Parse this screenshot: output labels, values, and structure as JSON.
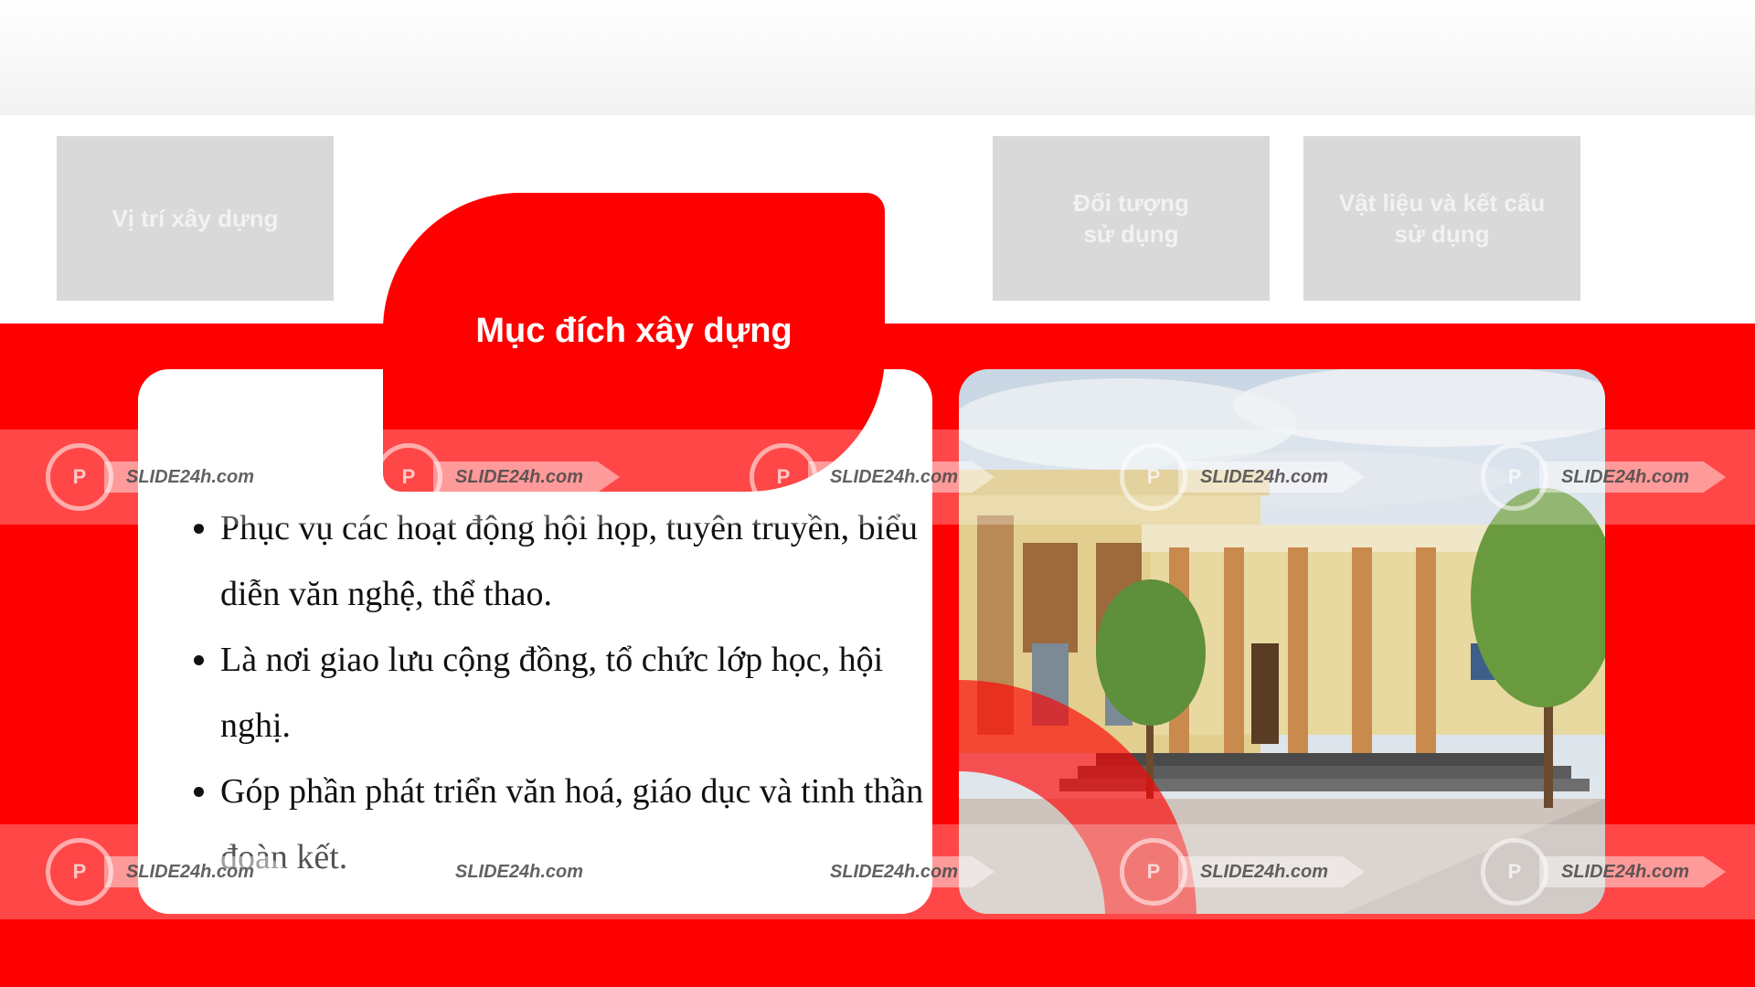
{
  "tabs": {
    "location": "Vị trí xây dựng",
    "users": "Đối tượng\nsử dụng",
    "materials": "Vật liệu và kết cấu\nsử dụng"
  },
  "active_tab": {
    "label": "Mục đích xây dựng"
  },
  "bullets": [
    "Phục vụ các hoạt động hội họp, tuyên truyền, biểu diễn văn nghệ, thể thao.",
    "Là nơi giao lưu cộng đồng, tổ chức lớp học, hội nghị.",
    "Góp phần phát triển văn hoá, giáo dục và tinh thần đoàn kết."
  ],
  "watermark": {
    "text": "SLIDE24h.com",
    "logo": "P"
  },
  "colors": {
    "accent": "#ff0000",
    "tab_inactive": "#d9d9d9"
  },
  "photo": {
    "icon": "building-photo"
  }
}
